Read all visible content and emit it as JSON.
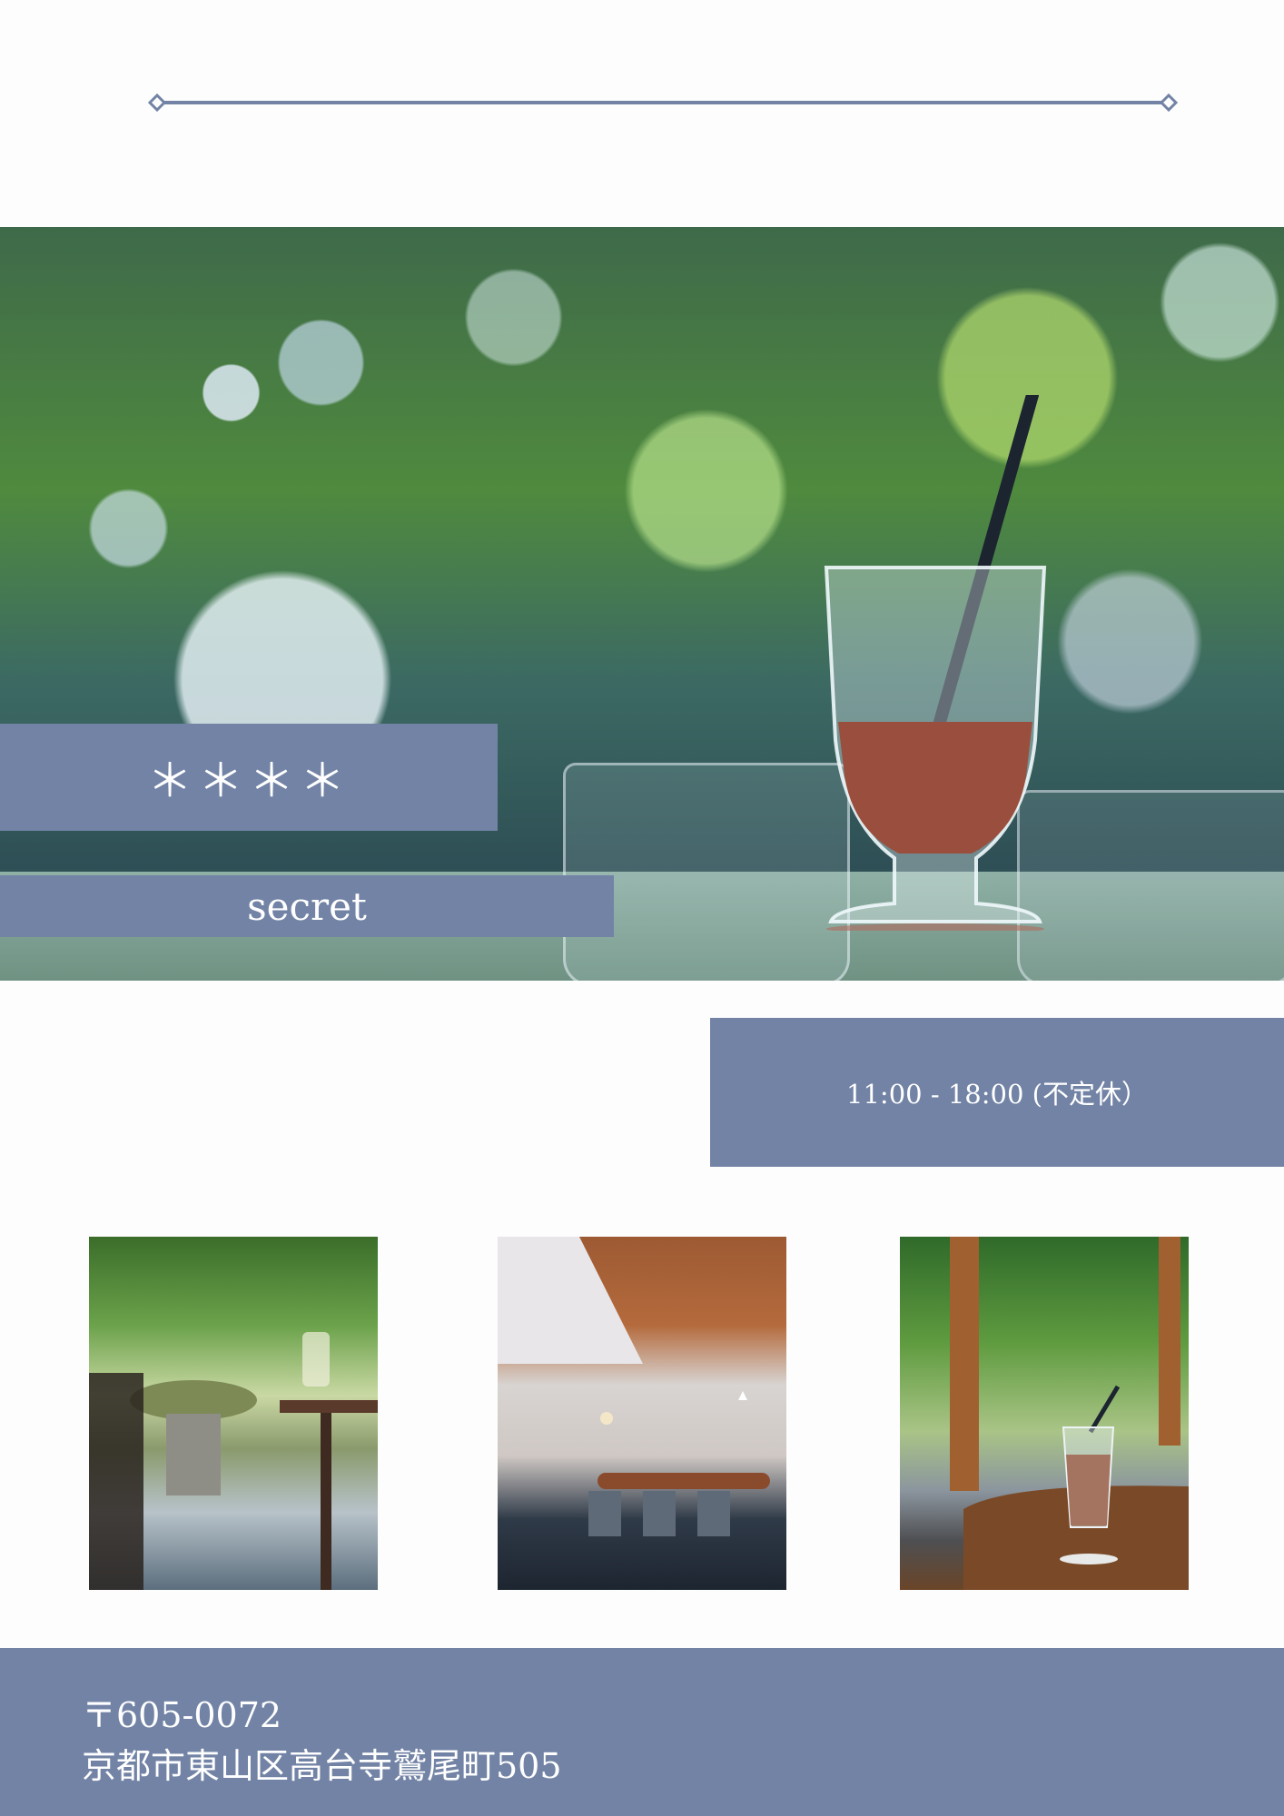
{
  "colors": {
    "accent": "#7283a5",
    "background": "#fdfdfd",
    "text_on_accent": "#ffffff"
  },
  "hero": {
    "stars": "＊＊＊＊",
    "subtitle": "secret"
  },
  "hours": {
    "text": "11:00 - 18:00 (不定休）"
  },
  "footer": {
    "postal": "〒605-0072",
    "address": "京都市東山区高台寺鷲尾町505"
  }
}
